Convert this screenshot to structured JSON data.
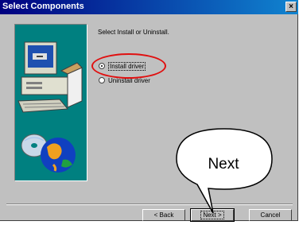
{
  "window": {
    "title": "Select Components",
    "close_glyph": "×"
  },
  "main": {
    "prompt": "Select Install or Uninstall.",
    "options": [
      {
        "label": "Install driver",
        "selected": true
      },
      {
        "label": "Uninstall driver",
        "selected": false
      }
    ]
  },
  "buttons": {
    "back": "< Back",
    "next": "Next >",
    "cancel": "Cancel"
  },
  "callout": {
    "text": "Next"
  },
  "colors": {
    "title_start": "#000080",
    "title_end": "#1084d0",
    "panel": "#008080",
    "highlight": "#e01010"
  }
}
